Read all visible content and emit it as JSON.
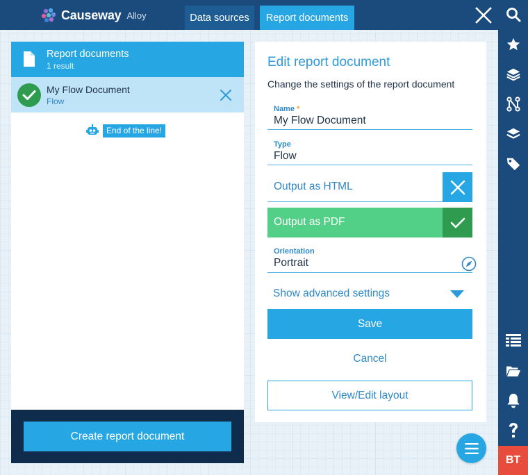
{
  "app": {
    "logo_name": "Causeway",
    "logo_sub": "Alloy"
  },
  "tabs": [
    {
      "label": "Data sources",
      "active": false
    },
    {
      "label": "Report documents",
      "active": true
    }
  ],
  "list": {
    "title": "Report documents",
    "count": "1 result",
    "items": [
      {
        "title": "My Flow Document",
        "subtitle": "Flow",
        "status": "check-icon"
      }
    ],
    "end_message": "End of the line!",
    "create_label": "Create report document"
  },
  "form": {
    "title": "Edit report document",
    "description": "Change the settings of the report document",
    "name": {
      "label": "Name",
      "required_mark": "*",
      "value": "My Flow Document"
    },
    "type": {
      "label": "Type",
      "value": "Flow"
    },
    "output_html": {
      "label": "Output as HTML",
      "enabled": false
    },
    "output_pdf": {
      "label": "Output as PDF",
      "enabled": true
    },
    "orientation": {
      "label": "Orientation",
      "value": "Portrait"
    },
    "advanced_label": "Show advanced settings",
    "save_label": "Save",
    "cancel_label": "Cancel",
    "layout_label": "View/Edit layout"
  },
  "rail": {
    "icons": [
      "search-icon",
      "star-icon",
      "layers-icon",
      "workflow-icon",
      "stack-icon",
      "tag-icon",
      "grid-list-icon",
      "folder-open-icon",
      "bell-icon",
      "help-icon"
    ],
    "user_initials": "BT"
  },
  "colors": {
    "navy": "#1b4b7c",
    "accent": "#27a6e4",
    "success": "#53d087",
    "success_dark": "#2e9b4e",
    "user_badge": "#e74c3c"
  }
}
